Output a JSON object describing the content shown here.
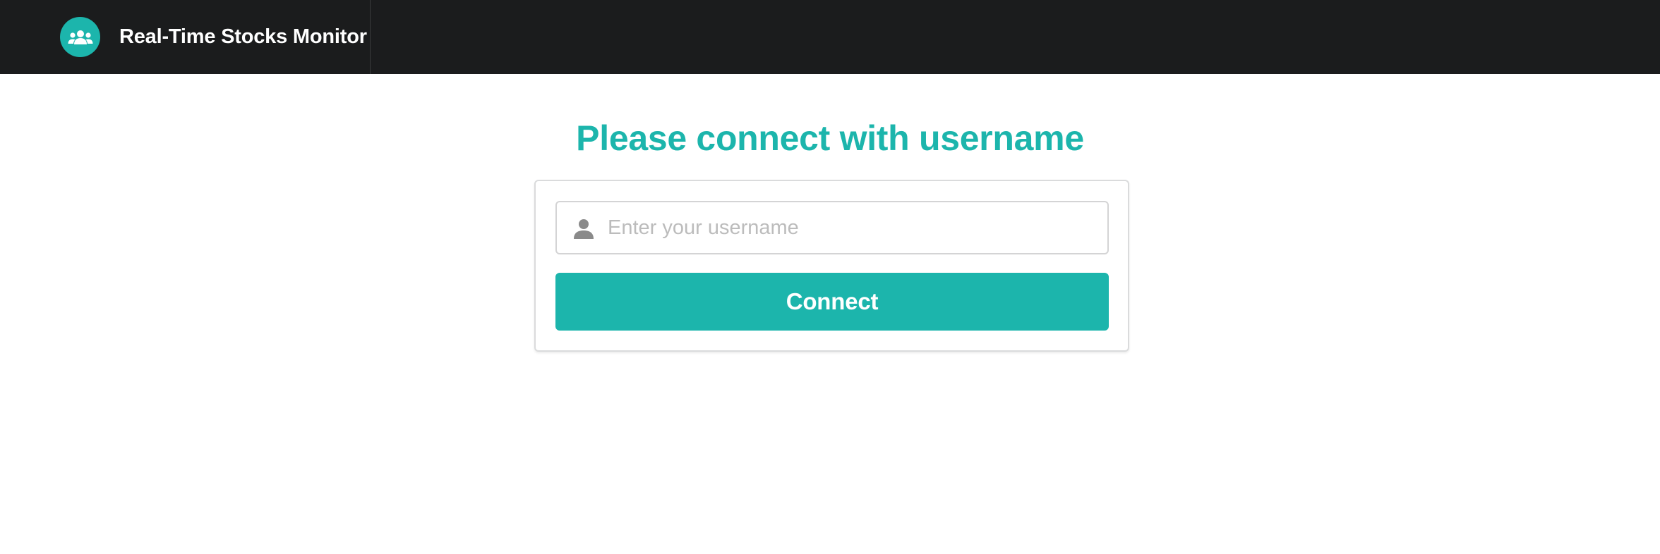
{
  "header": {
    "app_title": "Real-Time Stocks Monitor",
    "logo_icon": "users-icon"
  },
  "main": {
    "title": "Please connect with username"
  },
  "login_form": {
    "username_placeholder": "Enter your username",
    "username_value": "",
    "input_icon": "user-icon",
    "connect_label": "Connect"
  },
  "colors": {
    "accent": "#1cb5ac",
    "navbar": "#1b1c1d"
  }
}
